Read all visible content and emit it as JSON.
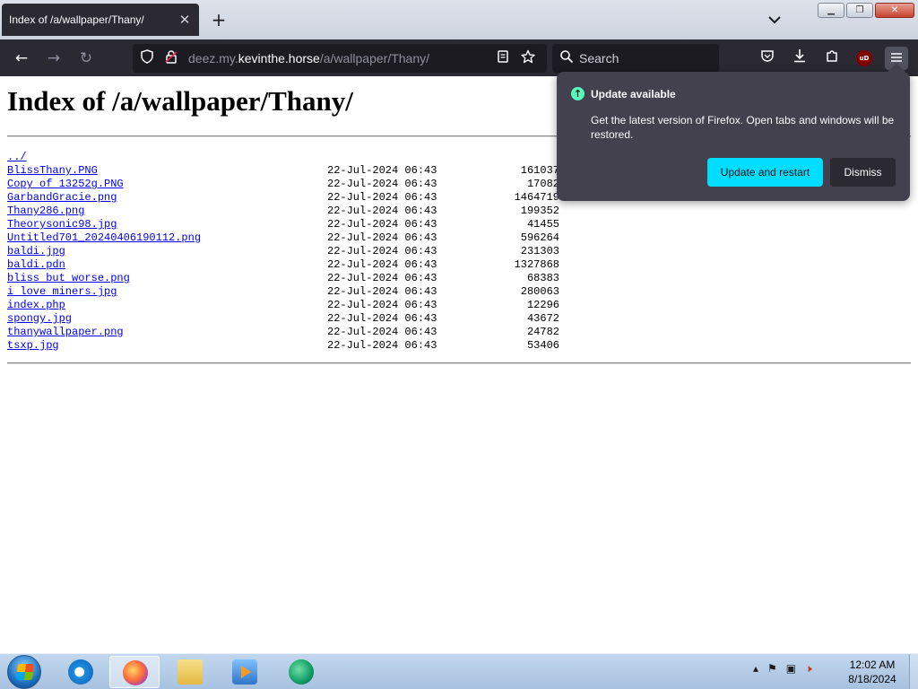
{
  "tab": {
    "title": "Index of /a/wallpaper/Thany/",
    "close": "✕",
    "new_tab": "+",
    "list_all": "⌄"
  },
  "window": {
    "minimize": "▁",
    "maximize": "❐",
    "close": "✕"
  },
  "nav": {
    "back": "←",
    "forward": "→",
    "reload": "↻",
    "url_prefix": "deez.my.",
    "url_host": "kevinthe.horse",
    "url_path": "/a/wallpaper/Thany/",
    "search_placeholder": "Search",
    "ubo_label": "uD"
  },
  "page": {
    "heading": "Index of /a/wallpaper/Thany/",
    "parent_link": "../",
    "files": [
      {
        "name": "BlissThany.PNG",
        "date": "22-Jul-2024 06:43",
        "size": "161037"
      },
      {
        "name": "Copy of 13252g.PNG",
        "date": "22-Jul-2024 06:43",
        "size": "17082"
      },
      {
        "name": "GarbandGracie.png",
        "date": "22-Jul-2024 06:43",
        "size": "1464719"
      },
      {
        "name": "Thany286.png",
        "date": "22-Jul-2024 06:43",
        "size": "199352"
      },
      {
        "name": "Theorysonic98.jpg",
        "date": "22-Jul-2024 06:43",
        "size": "41455"
      },
      {
        "name": "Untitled701_20240406190112.png",
        "date": "22-Jul-2024 06:43",
        "size": "596264"
      },
      {
        "name": "baldi.jpg",
        "date": "22-Jul-2024 06:43",
        "size": "231303"
      },
      {
        "name": "baldi.pdn",
        "date": "22-Jul-2024 06:43",
        "size": "1327868"
      },
      {
        "name": "bliss but worse.png",
        "date": "22-Jul-2024 06:43",
        "size": "68383"
      },
      {
        "name": "i love miners.jpg",
        "date": "22-Jul-2024 06:43",
        "size": "280063"
      },
      {
        "name": "index.php",
        "date": "22-Jul-2024 06:43",
        "size": "12296"
      },
      {
        "name": "spongy.jpg",
        "date": "22-Jul-2024 06:43",
        "size": "43672"
      },
      {
        "name": "thanywallpaper.png",
        "date": "22-Jul-2024 06:43",
        "size": "24782"
      },
      {
        "name": "tsxp.jpg",
        "date": "22-Jul-2024 06:43",
        "size": "53406"
      }
    ]
  },
  "update_popup": {
    "title": "Update available",
    "body": "Get the latest version of Firefox. Open tabs and windows will be restored.",
    "primary_button": "Update and restart",
    "secondary_button": "Dismiss"
  },
  "taskbar": {
    "clock_time": "12:02 AM",
    "clock_date": "8/18/2024"
  }
}
